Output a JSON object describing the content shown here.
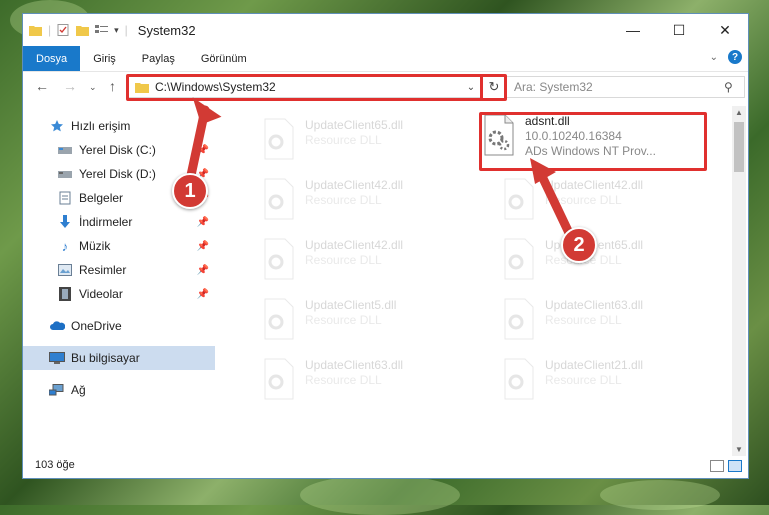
{
  "window": {
    "title": "System32",
    "controls": {
      "minimize": "—",
      "maximize": "☐",
      "close": "✕"
    }
  },
  "ribbon": {
    "tabs": [
      {
        "label": "Dosya",
        "active": true
      },
      {
        "label": "Giriş"
      },
      {
        "label": "Paylaş"
      },
      {
        "label": "Görünüm"
      }
    ],
    "help": "?"
  },
  "nav": {
    "address": "C:\\Windows\\System32",
    "search_placeholder": "Ara: System32"
  },
  "sidebar": {
    "items": [
      {
        "label": "Hızlı erişim",
        "icon": "star-icon"
      },
      {
        "label": "Yerel Disk (C:)",
        "icon": "drive-icon",
        "pinned": true
      },
      {
        "label": "Yerel Disk (D:)",
        "icon": "drive-icon",
        "pinned": true
      },
      {
        "label": "Belgeler",
        "icon": "documents-icon",
        "pinned": true
      },
      {
        "label": "İndirmeler",
        "icon": "download-icon",
        "pinned": true
      },
      {
        "label": "Müzik",
        "icon": "music-icon",
        "pinned": true
      },
      {
        "label": "Resimler",
        "icon": "pictures-icon",
        "pinned": true
      },
      {
        "label": "Videolar",
        "icon": "videos-icon",
        "pinned": true
      },
      {
        "label": "OneDrive",
        "icon": "cloud-icon"
      },
      {
        "label": "Bu bilgisayar",
        "icon": "computer-icon",
        "selected": true
      },
      {
        "label": "Ağ",
        "icon": "network-icon"
      }
    ]
  },
  "files": {
    "highlighted": {
      "name": "adsnt.dll",
      "version": "10.0.10240.16384",
      "description": "ADs Windows NT Prov..."
    },
    "faded": [
      {
        "name": "UpdateClient65.dll",
        "type": "Resource DLL"
      },
      {
        "name": "UpdateClient42.dll",
        "type": "Resource DLL"
      },
      {
        "name": "UpdateClient42.dll",
        "type": "Resource DLL"
      },
      {
        "name": "UpdateClient42.dll",
        "type": "Resource DLL"
      },
      {
        "name": "UpdateClient65.dll",
        "type": "Resource DLL"
      },
      {
        "name": "UpdateClient5.dll",
        "type": "Resource DLL"
      },
      {
        "name": "UpdateClient63.dll",
        "type": "Resource DLL"
      },
      {
        "name": "UpdateClient63.dll",
        "type": "Resource DLL"
      },
      {
        "name": "UpdateClient21.dll",
        "type": "Resource DLL"
      }
    ]
  },
  "status": {
    "count": "103 öğe"
  },
  "annotations": {
    "step1": "1",
    "step2": "2",
    "color": "#e0302e"
  }
}
